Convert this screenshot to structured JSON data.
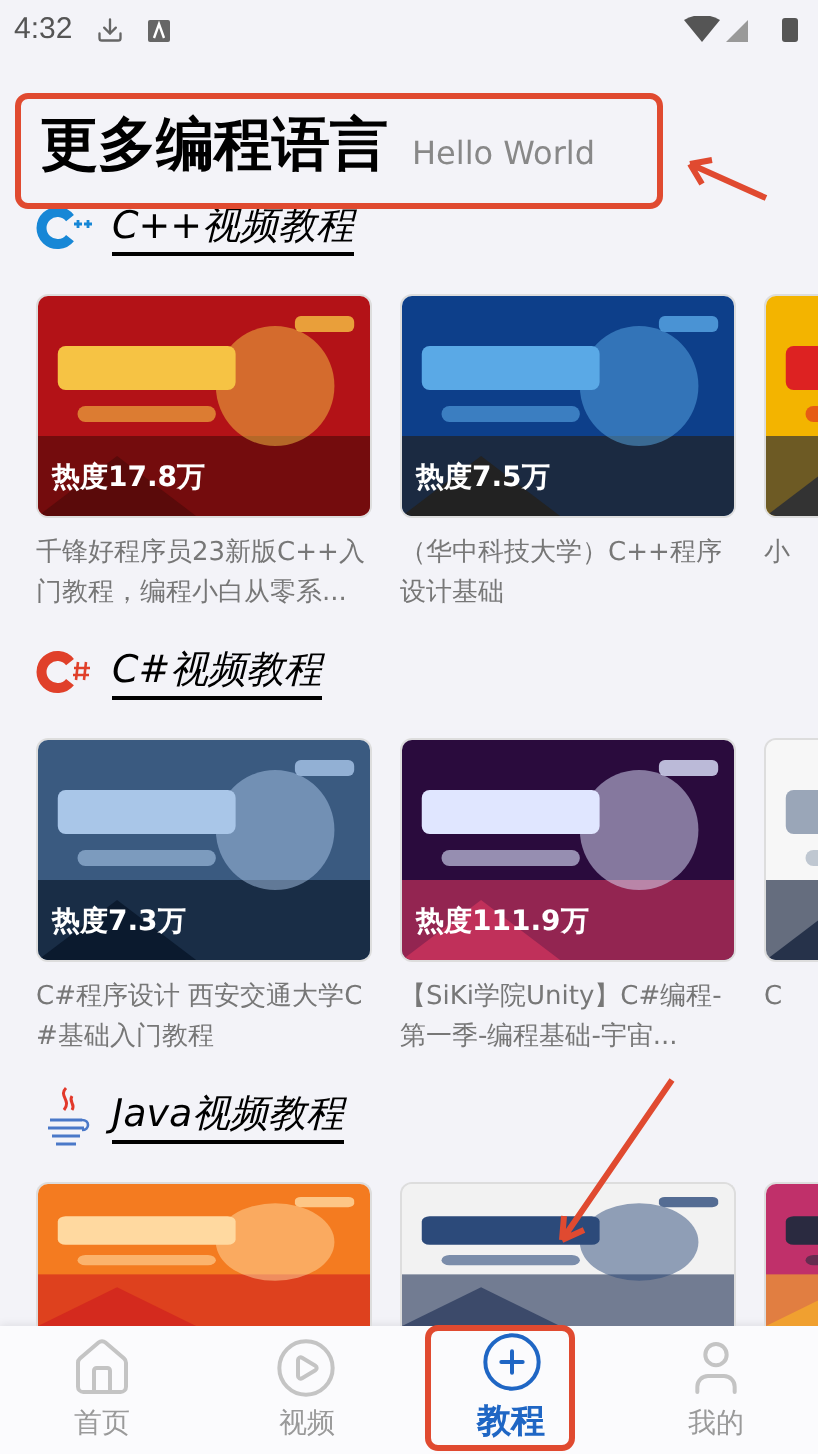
{
  "status_bar": {
    "time": "4:32"
  },
  "header": {
    "title": "更多编程语言",
    "subtitle": "Hello World"
  },
  "sections": [
    {
      "kind": "cpp",
      "title": "C++视频教程",
      "cards": [
        {
          "kind": "picture",
          "heat": "热度17.8万",
          "title": "千锋好程序员23新版C++入门教程，编程小白从零系..."
        },
        {
          "kind": "picture",
          "heat": "热度7.5万",
          "title": "（华中科技大学）C++程序设计基础"
        },
        {
          "kind": "picture",
          "title": "小"
        }
      ]
    },
    {
      "kind": "csharp",
      "title": "C#视频教程",
      "cards": [
        {
          "kind": "picture",
          "heat": "热度7.3万",
          "title": "C#程序设计 西安交通大学C#基础入门教程"
        },
        {
          "kind": "picture",
          "heat": "热度111.9万",
          "title": "【SiKi学院Unity】C#编程-第一季-编程基础-宇宙..."
        },
        {
          "kind": "picture",
          "title": "C"
        }
      ]
    },
    {
      "kind": "java",
      "title": "Java视频教程"
    }
  ],
  "bottom_nav": [
    {
      "kind": "home",
      "label": "首页",
      "selected": false
    },
    {
      "kind": "video",
      "label": "视频",
      "selected": false
    },
    {
      "kind": "tutorial",
      "label": "教程",
      "selected": true
    },
    {
      "kind": "profile",
      "label": "我的",
      "selected": false
    }
  ]
}
